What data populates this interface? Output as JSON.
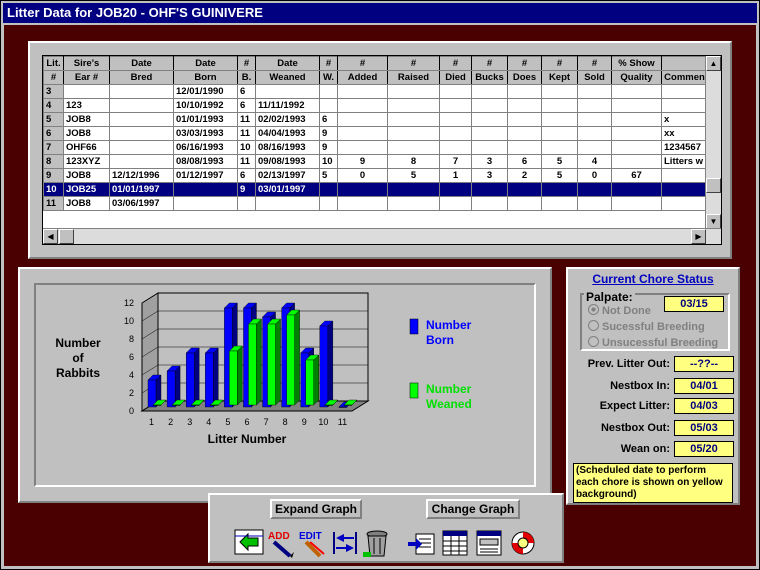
{
  "window": {
    "title": "Litter Data for JOB20 - OHF'S GUINIVERE"
  },
  "grid": {
    "headers_top": [
      "Lit.",
      "Sire's",
      "Date",
      "Date",
      "#",
      "Date",
      "#",
      "#",
      "#",
      "#",
      "#",
      "#",
      "#",
      "#",
      "% Show",
      ""
    ],
    "headers_bottom": [
      "#",
      "Ear #",
      "Bred",
      "Born",
      "B.",
      "Weaned",
      "W.",
      "Added",
      "Raised",
      "Died",
      "Bucks",
      "Does",
      "Kept",
      "Sold",
      "Quality",
      "Commen"
    ],
    "rows": [
      [
        "3",
        "",
        "",
        "12/01/1990",
        "6",
        "",
        "",
        "",
        "",
        "",
        "",
        "",
        "",
        "",
        "",
        ""
      ],
      [
        "4",
        "123",
        "",
        "10/10/1992",
        "6",
        "11/11/1992",
        "",
        "",
        "",
        "",
        "",
        "",
        "",
        "",
        "",
        ""
      ],
      [
        "5",
        "JOB8",
        "",
        "01/01/1993",
        "11",
        "02/02/1993",
        "6",
        "",
        "",
        "",
        "",
        "",
        "",
        "",
        "",
        "x"
      ],
      [
        "6",
        "JOB8",
        "",
        "03/03/1993",
        "11",
        "04/04/1993",
        "9",
        "",
        "",
        "",
        "",
        "",
        "",
        "",
        "",
        "xx"
      ],
      [
        "7",
        "OHF66",
        "",
        "06/16/1993",
        "10",
        "08/16/1993",
        "9",
        "",
        "",
        "",
        "",
        "",
        "",
        "",
        "",
        "1234567"
      ],
      [
        "8",
        "123XYZ",
        "",
        "08/08/1993",
        "11",
        "09/08/1993",
        "10",
        "9",
        "8",
        "7",
        "3",
        "6",
        "5",
        "4",
        "",
        "Litters w"
      ],
      [
        "9",
        "JOB8",
        "12/12/1996",
        "01/12/1997",
        "6",
        "02/13/1997",
        "5",
        "0",
        "5",
        "1",
        "3",
        "2",
        "5",
        "0",
        "67",
        ""
      ],
      [
        "10",
        "JOB25",
        "01/01/1997",
        "",
        "9",
        "03/01/1997",
        "",
        "",
        "",
        "",
        "",
        "",
        "",
        "",
        "",
        ""
      ],
      [
        "11",
        "JOB8",
        "03/06/1997",
        "",
        "",
        "",
        "",
        "",
        "",
        "",
        "",
        "",
        "",
        "",
        "",
        ""
      ]
    ],
    "selected_row": 7
  },
  "chart_data": {
    "type": "bar",
    "title": "",
    "xlabel": "Litter Number",
    "ylabel": "Number of Rabbits",
    "ylabel_lines": [
      "Number",
      "of",
      "Rabbits"
    ],
    "categories": [
      "1",
      "2",
      "3",
      "4",
      "5",
      "6",
      "7",
      "8",
      "9",
      "10",
      "11"
    ],
    "ylim": [
      0,
      12
    ],
    "yticks": [
      "0",
      "2",
      "4",
      "6",
      "8",
      "10",
      "12"
    ],
    "series": [
      {
        "name": "Number Born",
        "legend_lines": [
          "Number",
          "Born"
        ],
        "color": "#0000ff",
        "values": [
          3,
          4,
          6,
          6,
          11,
          11,
          10,
          11,
          6,
          9,
          0
        ]
      },
      {
        "name": "Number Weaned",
        "legend_lines": [
          "Number",
          "Weaned"
        ],
        "color": "#00ff00",
        "values": [
          0,
          0,
          0,
          0,
          6,
          9,
          9,
          10,
          5,
          0,
          0
        ]
      }
    ],
    "grid": true,
    "legend_placement": "right"
  },
  "chores": {
    "title": "Current Chore Status",
    "palpate": {
      "label": "Palpate:",
      "date": "03/15",
      "options": [
        "Not Done",
        "Sucessful Breeding",
        "Unsucessful Breeding"
      ],
      "selected": 0
    },
    "items": [
      {
        "label": "Prev. Litter Out:",
        "value": "--??--"
      },
      {
        "label": "Nestbox In:",
        "value": "04/01"
      },
      {
        "label": "Expect Litter:",
        "value": "04/03"
      },
      {
        "label": "Nestbox Out:",
        "value": "05/03"
      },
      {
        "label": "Wean on:",
        "value": "05/20"
      }
    ],
    "note": "(Scheduled date to perform each chore is shown on yellow background)"
  },
  "buttons": {
    "expand_graph": "Expand Graph",
    "change_graph": "Change Graph",
    "icon_add": "ADD",
    "icon_edit": "EDIT"
  },
  "colors": {
    "title_bar": "#000080",
    "background": "#4a0000",
    "highlight": "#ffff80",
    "born": "#0000ff",
    "weaned": "#00ff00"
  }
}
